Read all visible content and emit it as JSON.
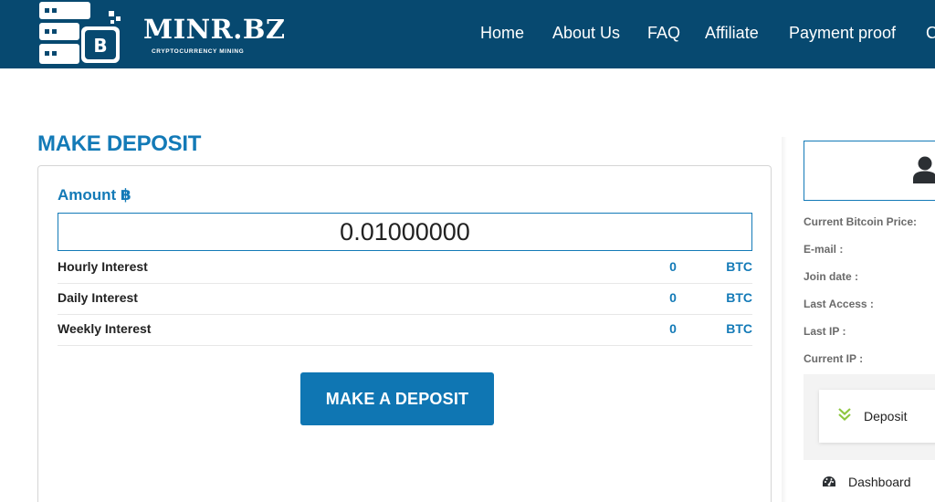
{
  "header": {
    "logo_text": "MINR.BZ",
    "logo_subtext": "CRYPTOCURRENCY MINING",
    "logo_badge": "B",
    "nav": [
      "Home",
      "About Us",
      "FAQ",
      "Affiliate",
      "Payment proof",
      "C"
    ]
  },
  "main": {
    "title": "MAKE DEPOSIT",
    "amount_label": "Amount ฿",
    "amount_value": "0.01000000",
    "rows": [
      {
        "label": "Hourly Interest",
        "value": "0",
        "unit": "BTC"
      },
      {
        "label": "Daily Interest",
        "value": "0",
        "unit": "BTC"
      },
      {
        "label": "Weekly Interest",
        "value": "0",
        "unit": "BTC"
      }
    ],
    "button_label": "MAKE A DEPOSIT"
  },
  "sidebar": {
    "info_labels": [
      "Current Bitcoin Price:",
      "E-mail :",
      "Join date :",
      "Last Access :",
      "Last IP :",
      "Current IP :"
    ],
    "menu": {
      "active_item": "Deposit",
      "dashboard": "Dashboard"
    }
  },
  "colors": {
    "header_bg": "#074970",
    "accent": "#137ab7",
    "button_bg": "#0f76b3",
    "deposit_chevron": "#8dc63f"
  },
  "icons": {
    "logo": "server-bitcoin-icon",
    "profile": "user-icon",
    "deposit": "double-chevron-down-icon",
    "dashboard": "speedometer-icon"
  }
}
